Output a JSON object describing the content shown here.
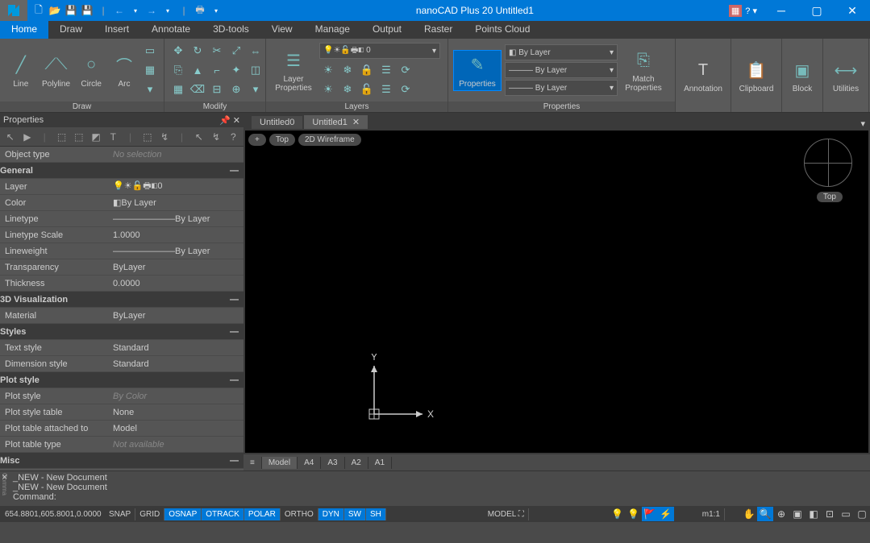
{
  "title": "nanoCAD Plus 20 Untitled1",
  "menus": [
    "Home",
    "Draw",
    "Insert",
    "Annotate",
    "3D-tools",
    "View",
    "Manage",
    "Output",
    "Raster",
    "Points Cloud"
  ],
  "active_menu": 0,
  "ribbon": {
    "draw": {
      "label": "Draw",
      "line": "Line",
      "polyline": "Polyline",
      "circle": "Circle",
      "arc": "Arc"
    },
    "modify": {
      "label": "Modify"
    },
    "layers": {
      "label": "Layers",
      "layer_properties": "Layer\nProperties",
      "layer0": "0"
    },
    "properties": {
      "label": "Properties",
      "properties_btn": "Properties",
      "by_layer": "By Layer",
      "match": "Match\nProperties"
    },
    "annotation": "Annotation",
    "clipboard": "Clipboard",
    "block": "Block",
    "utilities": "Utilities"
  },
  "properties_panel": {
    "title": "Properties",
    "object_type": {
      "k": "Object type",
      "v": "No selection"
    },
    "sections": {
      "general": "General",
      "viz": "3D Visualization",
      "styles": "Styles",
      "plot": "Plot style",
      "misc": "Misc"
    },
    "rows": {
      "layer": {
        "k": "Layer",
        "v": "0"
      },
      "color": {
        "k": "Color",
        "v": "By Layer"
      },
      "linetype": {
        "k": "Linetype",
        "v": "———————By Layer"
      },
      "linetype_scale": {
        "k": "Linetype Scale",
        "v": "1.0000"
      },
      "lineweight": {
        "k": "Lineweight",
        "v": "———————By Layer"
      },
      "transparency": {
        "k": "Transparency",
        "v": "ByLayer"
      },
      "thickness": {
        "k": "Thickness",
        "v": "0.0000"
      },
      "material": {
        "k": "Material",
        "v": "ByLayer"
      },
      "text_style": {
        "k": "Text style",
        "v": "Standard"
      },
      "dimension_style": {
        "k": "Dimension style",
        "v": "Standard"
      },
      "plot_style": {
        "k": "Plot style",
        "v": "By Color"
      },
      "plot_style_table": {
        "k": "Plot style table",
        "v": "None"
      },
      "plot_table_attached": {
        "k": "Plot table attached to",
        "v": "Model"
      },
      "plot_table_type": {
        "k": "Plot table type",
        "v": "Not available"
      }
    }
  },
  "doc_tabs": {
    "inactive": "Untitled0",
    "active": "Untitled1"
  },
  "viewport": {
    "top": "Top",
    "wire": "2D Wireframe",
    "compass_label": "Top",
    "axis_x": "X",
    "axis_y": "Y"
  },
  "model_tabs": [
    "Model",
    "A4",
    "A3",
    "A2",
    "A1"
  ],
  "command": {
    "line1": "_NEW - New Document",
    "line2": "_NEW - New Document",
    "prompt": "Command:"
  },
  "status": {
    "coords": "654.8801,605.8001,0.0000",
    "buttons": [
      {
        "t": "SNAP",
        "on": false
      },
      {
        "t": "GRID",
        "on": false
      },
      {
        "t": "OSNAP",
        "on": true
      },
      {
        "t": "OTRACK",
        "on": true
      },
      {
        "t": "POLAR",
        "on": true
      },
      {
        "t": "ORTHO",
        "on": false
      },
      {
        "t": "DYN",
        "on": true
      },
      {
        "t": "SW",
        "on": true
      },
      {
        "t": "SH",
        "on": true
      }
    ],
    "model": "MODEL",
    "scale": "m1:1"
  }
}
